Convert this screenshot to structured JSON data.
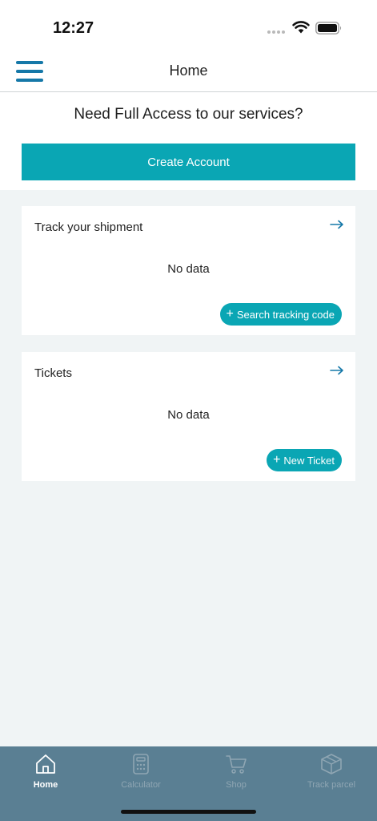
{
  "status_bar": {
    "time": "12:27"
  },
  "header": {
    "title": "Home"
  },
  "promo": {
    "heading": "Need Full Access to our services?",
    "button_label": "Create Account"
  },
  "cards": [
    {
      "title": "Track your shipment",
      "empty_text": "No data",
      "action_label": "Search tracking code"
    },
    {
      "title": "Tickets",
      "empty_text": "No data",
      "action_label": "New Ticket"
    }
  ],
  "bottom_nav": {
    "items": [
      {
        "label": "Home",
        "icon": "home-icon",
        "active": true
      },
      {
        "label": "Calculator",
        "icon": "calculator-icon",
        "active": false
      },
      {
        "label": "Shop",
        "icon": "cart-icon",
        "active": false
      },
      {
        "label": "Track parcel",
        "icon": "package-icon",
        "active": false
      }
    ]
  },
  "colors": {
    "accent": "#0aa6b4",
    "menu": "#1578a8",
    "nav_bar": "#5a7f93",
    "background": "#f0f4f5"
  }
}
